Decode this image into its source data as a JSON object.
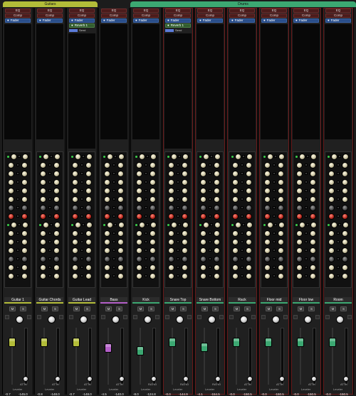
{
  "groups": [
    {
      "label": "Guitars",
      "color": "#b3bd39"
    },
    {
      "label": "Drums",
      "color": "#3ca872"
    }
  ],
  "inserts": [
    "EQ",
    "Comp"
  ],
  "fader_label": "Fader",
  "reverb_send": "Reverb 1",
  "send_label": "Send",
  "buttons": {
    "mute": "M",
    "solo": "S"
  },
  "channels": [
    {
      "name": "Guitar 1",
      "color": "#b3bd39",
      "plugin": "ATTK",
      "vol": "-0.7",
      "peak": "-145.0",
      "output": "Gtrs",
      "mode": "Post",
      "fader_level": 0.82,
      "red": false
    },
    {
      "name": "Guitar Chords",
      "color": "#b3bd39",
      "plugin": "ATTK",
      "vol": "-0.8",
      "peak": "-148.0",
      "output": "Gtrs",
      "mode": "Post",
      "fader_level": 0.82,
      "red": false
    },
    {
      "name": "Guitar Lead",
      "color": "#b3bd39",
      "plugin": "ATTK",
      "vol": "-0.7",
      "peak": "-148.0",
      "output": "Gtrs",
      "mode": "Post",
      "fader_level": 0.82,
      "red": false
    },
    {
      "name": "Bass",
      "color": "#b45fc8",
      "plugin": "ATTK",
      "vol": "-4.5",
      "peak": "-140.0",
      "output": "Grp",
      "mode": "Post",
      "fader_level": 0.72,
      "red": false
    },
    {
      "name": "Kick",
      "color": "#3ca872",
      "plugin": "RATIO",
      "vol": "-8.0",
      "peak": "-124.8",
      "output": "Drums",
      "mode": "Post",
      "fader_level": 0.68,
      "red": false
    },
    {
      "name": "Snare Top",
      "color": "#3ca872",
      "plugin": "RATIO",
      "vol": "-0.0",
      "peak": "-144.9",
      "output": "Drums",
      "mode": "Post",
      "fader_level": 0.82,
      "red": true
    },
    {
      "name": "Snare Bottom",
      "color": "#3ca872",
      "plugin": "RATIO",
      "vol": "-4.1",
      "peak": "-154.5",
      "output": "Drums",
      "mode": "Post",
      "fader_level": 0.74,
      "red": true
    },
    {
      "name": "Rack",
      "color": "#3ca872",
      "plugin": "ATTK",
      "vol": "-0.0",
      "peak": "-150.5",
      "output": "Drums",
      "mode": "Post",
      "fader_level": 0.82,
      "red": true
    },
    {
      "name": "Floor mid",
      "color": "#3ca872",
      "plugin": "ATTK",
      "vol": "-0.0",
      "peak": "-150.5",
      "output": "Drums",
      "mode": "Post",
      "fader_level": 0.82,
      "red": true
    },
    {
      "name": "Floor low",
      "color": "#3ca872",
      "plugin": "ATTK",
      "vol": "-0.0",
      "peak": "-150.5",
      "output": "Drums",
      "mode": "Post",
      "fader_level": 0.82,
      "red": true
    },
    {
      "name": "Room",
      "color": "#3ca872",
      "plugin": "ATTK",
      "vol": "-0.0",
      "peak": "-150.5",
      "output": "Drums",
      "mode": "Post",
      "fader_level": 0.82,
      "red": true
    }
  ],
  "sub_labels": {
    "comp": "Compre",
    "leveler": "Leveler"
  },
  "reverb_on_channels": [
    2,
    5
  ]
}
